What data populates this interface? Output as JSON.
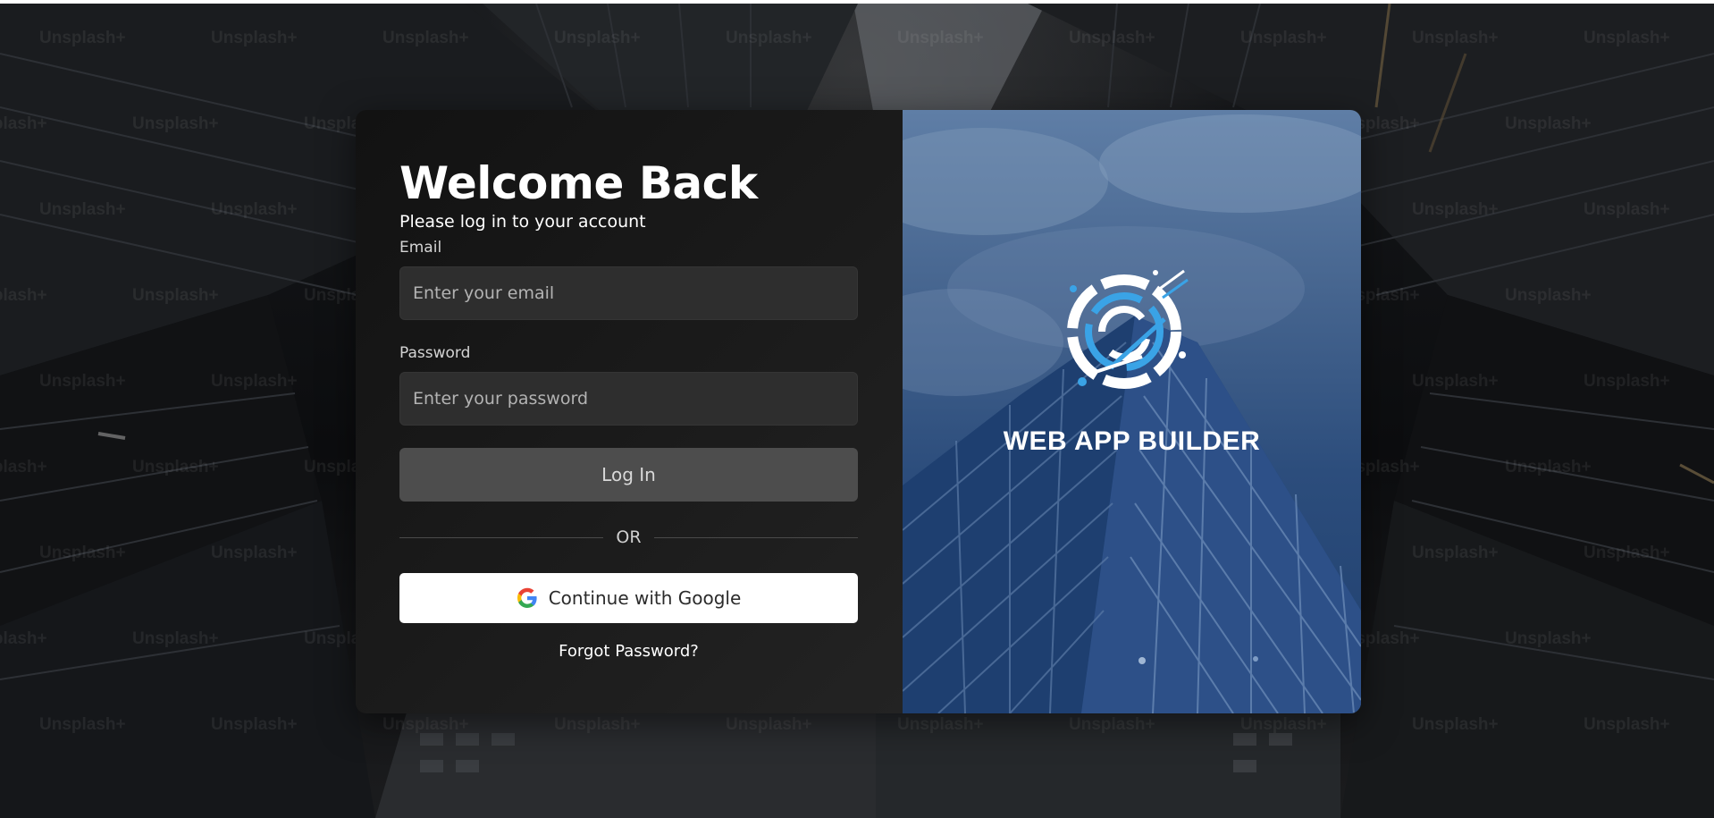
{
  "background": {
    "watermark_text": "Unsplash+"
  },
  "login": {
    "title": "Welcome Back",
    "subtitle": "Please log in to your account",
    "email_label": "Email",
    "email_placeholder": "Enter your email",
    "email_value": "",
    "password_label": "Password",
    "password_placeholder": "Enter your password",
    "password_value": "",
    "login_button": "Log In",
    "divider_text": "OR",
    "google_button": "Continue with Google",
    "forgot_link": "Forgot Password?"
  },
  "brand": {
    "name": "WEB APP BUILDER",
    "logo_icon": "circuit-gear-logo-icon"
  },
  "colors": {
    "panel_dark": "#1b1b1b",
    "input_bg": "#2e2e2e",
    "login_button_bg": "#4d4d4d",
    "google_button_bg": "#ffffff",
    "brand_panel": "#2c4d7c",
    "logo_accent": "#3aa3e6",
    "google_blue": "#4285F4",
    "google_red": "#EA4335",
    "google_yellow": "#FBBC05",
    "google_green": "#34A853"
  }
}
